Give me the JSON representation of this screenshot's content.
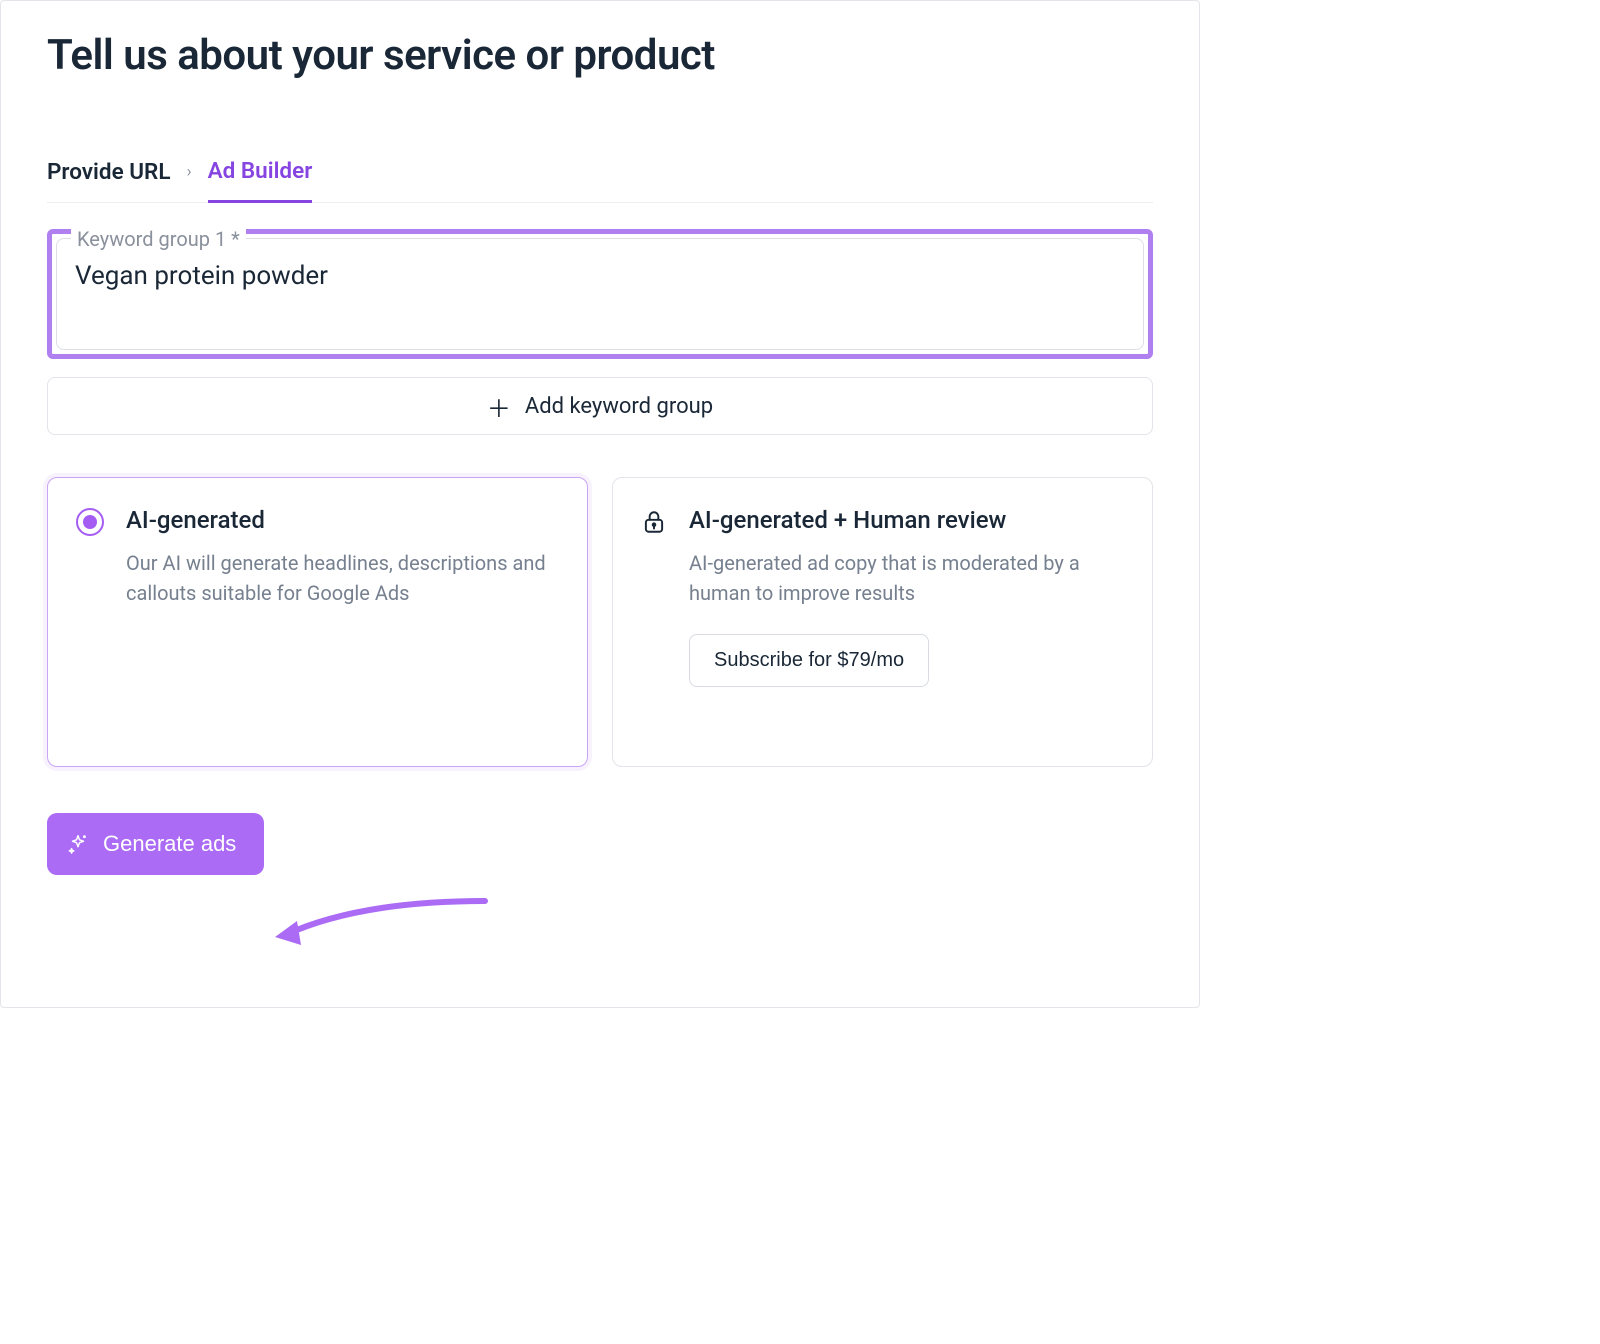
{
  "page": {
    "title": "Tell us about your service or product"
  },
  "breadcrumb": {
    "step1": "Provide URL",
    "step2": "Ad Builder"
  },
  "keyword_group": {
    "label": "Keyword group 1 *",
    "value": "Vegan protein powder"
  },
  "add_keyword_label": "Add keyword group",
  "options": {
    "ai": {
      "title": "AI-generated",
      "desc": "Our AI will generate headlines, descriptions and callouts suitable for Google Ads"
    },
    "human": {
      "title": "AI-generated + Human review",
      "desc": "AI-generated ad copy that is moderated by a human to improve results",
      "subscribe_label": "Subscribe for $79/mo"
    }
  },
  "generate_label": "Generate ads"
}
